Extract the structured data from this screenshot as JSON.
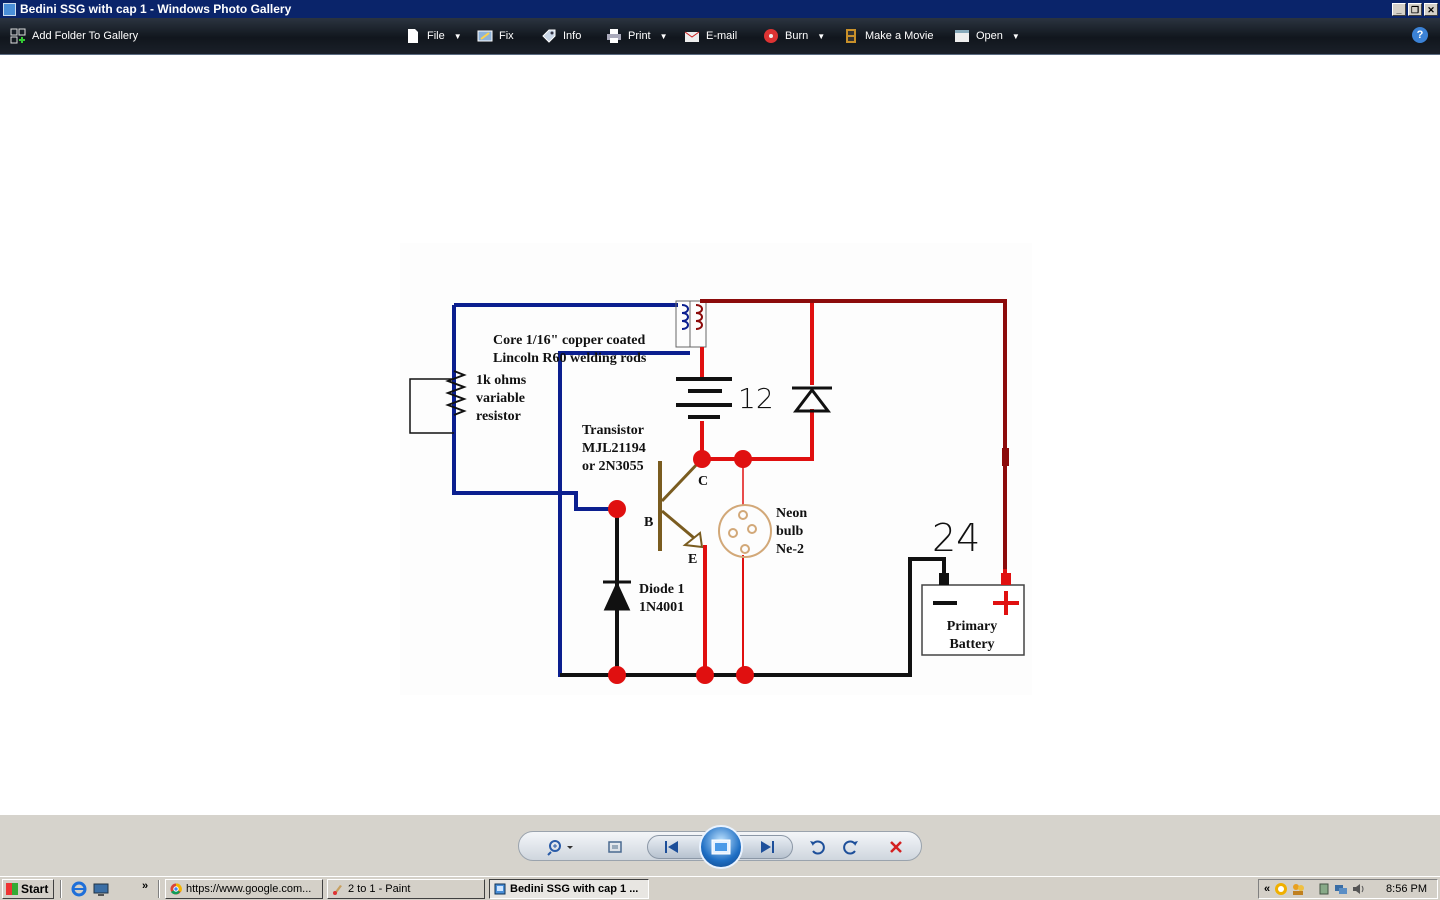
{
  "window": {
    "title": "Bedini SSG with cap 1 - Windows Photo Gallery",
    "buttons": [
      "_",
      "❐",
      "✕"
    ]
  },
  "toolbar": {
    "add_folder": "Add Folder To Gallery",
    "file": "File",
    "fix": "Fix",
    "info": "Info",
    "print": "Print",
    "email": "E-mail",
    "burn": "Burn",
    "make_movie": "Make a Movie",
    "open": "Open",
    "help": "?"
  },
  "diagram": {
    "core_line1": "Core 1/16\" copper coated",
    "core_line2": "Lincoln R60 welding rods",
    "resistor_line1": "1k ohms",
    "resistor_line2": "variable",
    "resistor_line3": "resistor",
    "transistor_line1": "Transistor",
    "transistor_line2": "MJL21194",
    "transistor_line3": "or 2N3055",
    "label_c": "C",
    "label_b": "B",
    "label_e": "E",
    "label_12": "12",
    "neon_line1": "Neon",
    "neon_line2": "bulb",
    "neon_line3": "Ne-2",
    "label_24": "24",
    "diode_line1": "Diode 1",
    "diode_line2": "1N4001",
    "battery_line1": "Primary",
    "battery_line2": "Battery",
    "colors": {
      "blue": "#0b1f8f",
      "red": "#e01010",
      "darkred": "#8c0b0b",
      "black": "#111111"
    }
  },
  "taskbar": {
    "start": "Start",
    "chevron": "»",
    "tasks": [
      {
        "label": "https://www.google.com...",
        "icon": "chrome-icon"
      },
      {
        "label": "2 to 1 - Paint",
        "icon": "paint-icon"
      },
      {
        "label": "Bedini SSG with cap 1 ...",
        "icon": "photo-gallery-icon",
        "active": true
      }
    ],
    "tray_chevron": "«",
    "clock": "8:56 PM"
  }
}
